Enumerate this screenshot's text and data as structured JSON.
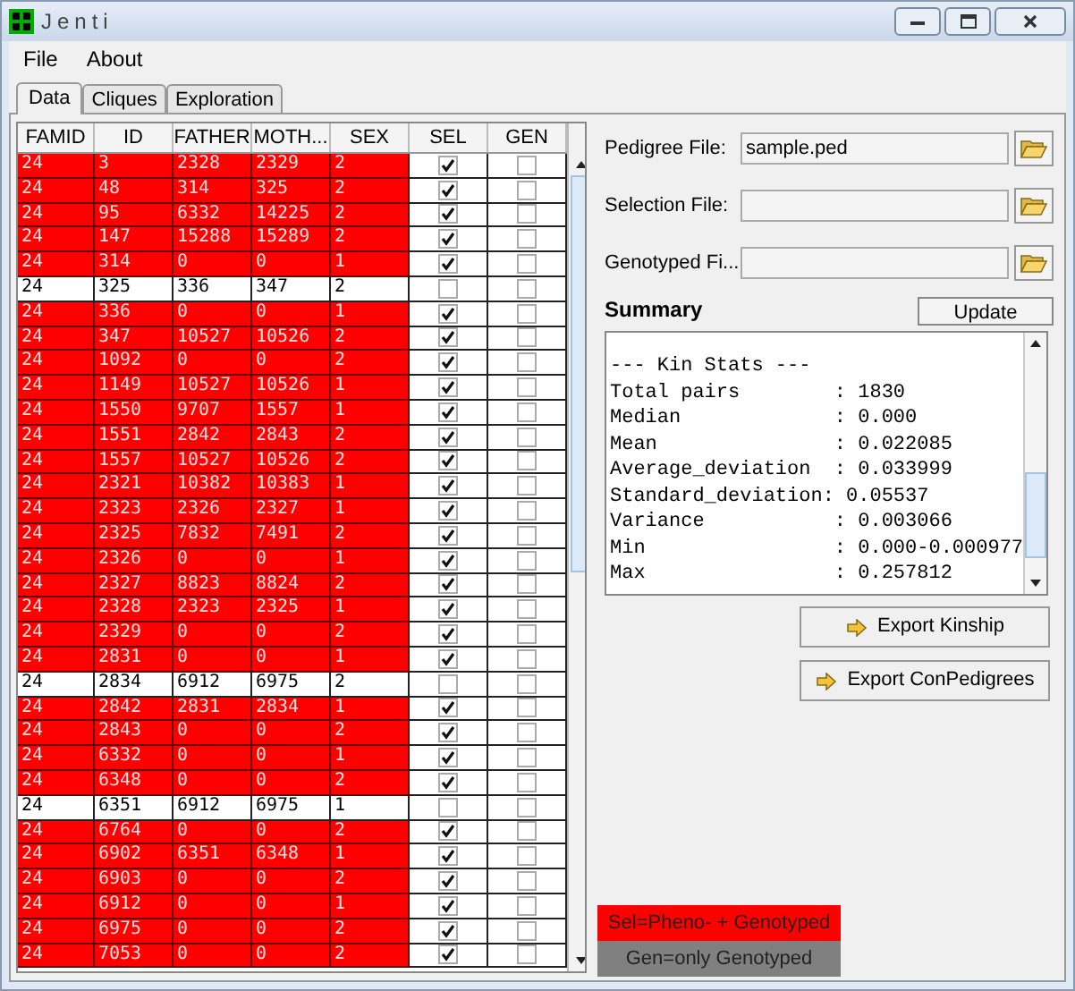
{
  "window": {
    "title": "Jenti"
  },
  "menu": [
    "File",
    "About"
  ],
  "tabs": [
    {
      "label": "Data",
      "selected": true
    },
    {
      "label": "Cliques",
      "selected": false
    },
    {
      "label": "Exploration",
      "selected": false
    }
  ],
  "table": {
    "columns": [
      "FAMID",
      "ID",
      "FATHER",
      "MOTH...",
      "SEX",
      "SEL",
      "GEN"
    ],
    "rows": [
      {
        "cells": [
          "24",
          "3",
          "2328",
          "2329",
          "2"
        ],
        "sel": true,
        "gen": false
      },
      {
        "cells": [
          "24",
          "48",
          "314",
          "325",
          "2"
        ],
        "sel": true,
        "gen": false
      },
      {
        "cells": [
          "24",
          "95",
          "6332",
          "14225",
          "2"
        ],
        "sel": true,
        "gen": false
      },
      {
        "cells": [
          "24",
          "147",
          "15288",
          "15289",
          "2"
        ],
        "sel": true,
        "gen": false
      },
      {
        "cells": [
          "24",
          "314",
          "0",
          "0",
          "1"
        ],
        "sel": true,
        "gen": false
      },
      {
        "cells": [
          "24",
          "325",
          "336",
          "347",
          "2"
        ],
        "sel": false,
        "gen": false
      },
      {
        "cells": [
          "24",
          "336",
          "0",
          "0",
          "1"
        ],
        "sel": true,
        "gen": false
      },
      {
        "cells": [
          "24",
          "347",
          "10527",
          "10526",
          "2"
        ],
        "sel": true,
        "gen": false
      },
      {
        "cells": [
          "24",
          "1092",
          "0",
          "0",
          "2"
        ],
        "sel": true,
        "gen": false
      },
      {
        "cells": [
          "24",
          "1149",
          "10527",
          "10526",
          "1"
        ],
        "sel": true,
        "gen": false
      },
      {
        "cells": [
          "24",
          "1550",
          "9707",
          "1557",
          "1"
        ],
        "sel": true,
        "gen": false
      },
      {
        "cells": [
          "24",
          "1551",
          "2842",
          "2843",
          "2"
        ],
        "sel": true,
        "gen": false
      },
      {
        "cells": [
          "24",
          "1557",
          "10527",
          "10526",
          "2"
        ],
        "sel": true,
        "gen": false
      },
      {
        "cells": [
          "24",
          "2321",
          "10382",
          "10383",
          "1"
        ],
        "sel": true,
        "gen": false
      },
      {
        "cells": [
          "24",
          "2323",
          "2326",
          "2327",
          "1"
        ],
        "sel": true,
        "gen": false
      },
      {
        "cells": [
          "24",
          "2325",
          "7832",
          "7491",
          "2"
        ],
        "sel": true,
        "gen": false
      },
      {
        "cells": [
          "24",
          "2326",
          "0",
          "0",
          "1"
        ],
        "sel": true,
        "gen": false
      },
      {
        "cells": [
          "24",
          "2327",
          "8823",
          "8824",
          "2"
        ],
        "sel": true,
        "gen": false
      },
      {
        "cells": [
          "24",
          "2328",
          "2323",
          "2325",
          "1"
        ],
        "sel": true,
        "gen": false
      },
      {
        "cells": [
          "24",
          "2329",
          "0",
          "0",
          "2"
        ],
        "sel": true,
        "gen": false
      },
      {
        "cells": [
          "24",
          "2831",
          "0",
          "0",
          "1"
        ],
        "sel": true,
        "gen": false
      },
      {
        "cells": [
          "24",
          "2834",
          "6912",
          "6975",
          "2"
        ],
        "sel": false,
        "gen": false
      },
      {
        "cells": [
          "24",
          "2842",
          "2831",
          "2834",
          "1"
        ],
        "sel": true,
        "gen": false
      },
      {
        "cells": [
          "24",
          "2843",
          "0",
          "0",
          "2"
        ],
        "sel": true,
        "gen": false
      },
      {
        "cells": [
          "24",
          "6332",
          "0",
          "0",
          "1"
        ],
        "sel": true,
        "gen": false
      },
      {
        "cells": [
          "24",
          "6348",
          "0",
          "0",
          "2"
        ],
        "sel": true,
        "gen": false
      },
      {
        "cells": [
          "24",
          "6351",
          "6912",
          "6975",
          "1"
        ],
        "sel": false,
        "gen": false
      },
      {
        "cells": [
          "24",
          "6764",
          "0",
          "0",
          "2"
        ],
        "sel": true,
        "gen": false
      },
      {
        "cells": [
          "24",
          "6902",
          "6351",
          "6348",
          "1"
        ],
        "sel": true,
        "gen": false
      },
      {
        "cells": [
          "24",
          "6903",
          "0",
          "0",
          "2"
        ],
        "sel": true,
        "gen": false
      },
      {
        "cells": [
          "24",
          "6912",
          "0",
          "0",
          "1"
        ],
        "sel": true,
        "gen": false
      },
      {
        "cells": [
          "24",
          "6975",
          "0",
          "0",
          "2"
        ],
        "sel": true,
        "gen": false
      },
      {
        "cells": [
          "24",
          "7053",
          "0",
          "0",
          "2"
        ],
        "sel": true,
        "gen": false
      }
    ]
  },
  "files": [
    {
      "label": "Pedigree File:",
      "value": "sample.ped"
    },
    {
      "label": "Selection File:"
    },
    {
      "label": "Genotyped Fi..."
    }
  ],
  "summary": {
    "title": "Summary",
    "button": "Update",
    "lines": [
      "--- Kin Stats ---",
      "Total pairs        : 1830",
      "Median             : 0.000",
      "Mean               : 0.022085",
      "Average_deviation  : 0.033999",
      "Standard_deviation: 0.05537",
      "Variance           : 0.003066",
      "Min                : 0.000-0.000977",
      "Max                : 0.257812"
    ]
  },
  "buttons": [
    "Export Kinship",
    "Export ConPedigrees"
  ],
  "legend": [
    {
      "label": "Sel=Pheno- + Genotyped",
      "color": "#ff0000"
    },
    {
      "label": "Gen=only Genotyped",
      "color": "#808080"
    }
  ]
}
